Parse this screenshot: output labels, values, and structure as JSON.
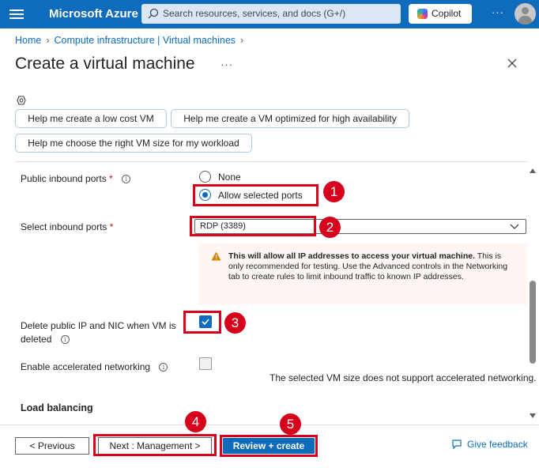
{
  "topbar": {
    "brand": "Microsoft Azure",
    "search_placeholder": "Search resources, services, and docs (G+/)",
    "copilot_label": "Copilot",
    "more": "···"
  },
  "breadcrumb": {
    "home": "Home",
    "section": "Compute infrastructure | Virtual machines"
  },
  "page": {
    "title": "Create a virtual machine",
    "title_more": "···"
  },
  "suggestions": [
    "Help me create a low cost VM",
    "Help me create a VM optimized for high availability",
    "Help me choose the right VM size for my workload"
  ],
  "form": {
    "inbound_ports_label": "Public inbound ports",
    "required_mark": "*",
    "radio_none": "None",
    "radio_allow": "Allow selected ports",
    "radio_selected": "Allow selected ports",
    "select_ports_label": "Select inbound ports",
    "select_ports_value": "RDP (3389)",
    "warning_bold": "This will allow all IP addresses to access your virtual machine.",
    "warning_text": "This is only recommended for testing.  Use the Advanced controls in the Networking tab to create rules to limit inbound traffic to known IP addresses.",
    "delete_ip_label": "Delete public IP and NIC when VM is deleted",
    "delete_ip_checked": true,
    "accel_net_label": "Enable accelerated networking",
    "accel_net_checked": false,
    "accel_net_note": "The selected VM size does not support accelerated networking.",
    "section_load_balancing": "Load balancing"
  },
  "footer": {
    "previous": "< Previous",
    "next": "Next : Management >",
    "review": "Review + create",
    "feedback": "Give feedback"
  },
  "annotations": [
    "1",
    "2",
    "3",
    "4",
    "5"
  ],
  "colors": {
    "accent": "#0f6cbd",
    "annotation": "#d6001c",
    "warning": "#d67f00"
  }
}
